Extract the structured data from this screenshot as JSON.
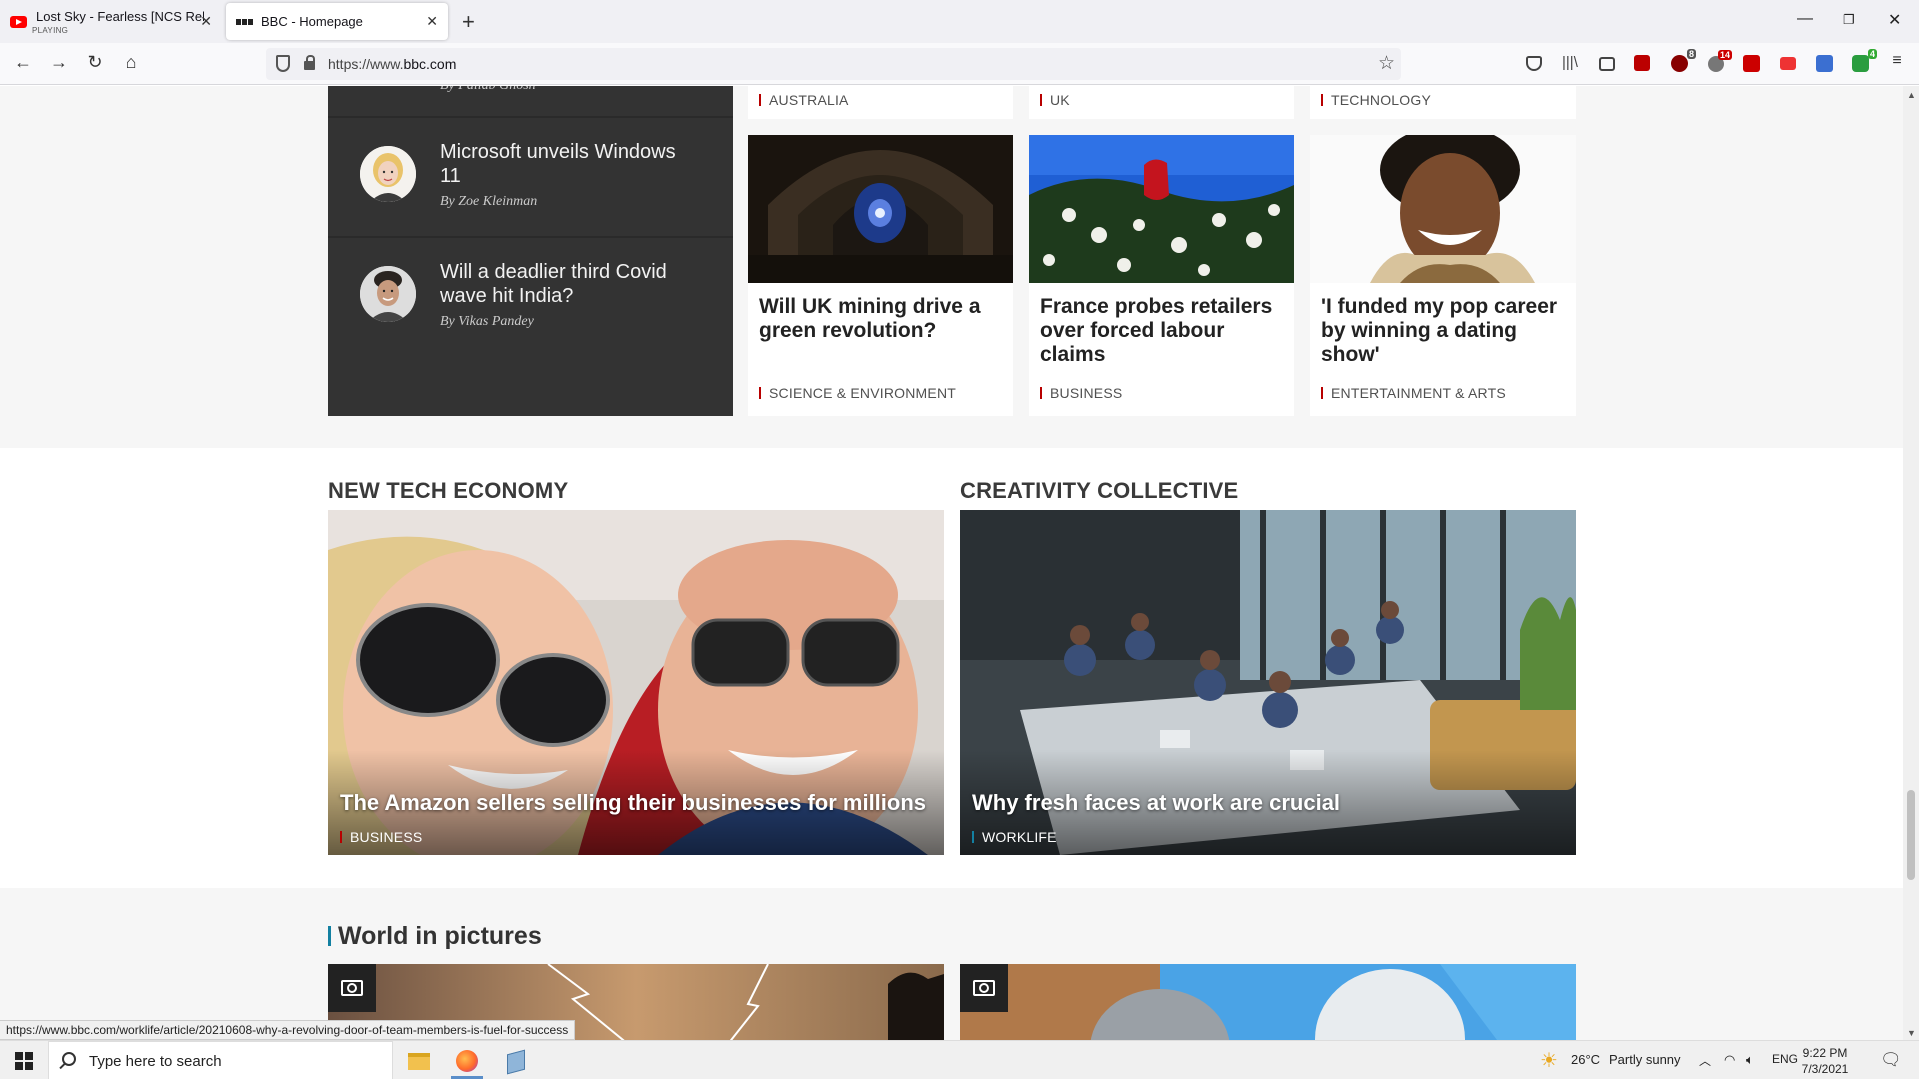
{
  "browser": {
    "tabs": [
      {
        "title": "Lost Sky - Fearless [NCS Release]",
        "sub": "PLAYING"
      },
      {
        "title": "BBC - Homepage"
      }
    ],
    "url_prefix": "https://www.",
    "url_domain": "bbc.com"
  },
  "authors_panel": {
    "partial_name": "By Pallab Ghosh",
    "items": [
      {
        "title": "Microsoft unveils Windows 11",
        "author": "By Zoe Kleinman"
      },
      {
        "title": "Will a deadlier third Covid wave hit India?",
        "author": "By Vikas Pandey"
      }
    ]
  },
  "top_tags": [
    "AUSTRALIA",
    "UK",
    "TECHNOLOGY"
  ],
  "cards": [
    {
      "title": "Will UK mining drive a green revolution?",
      "tag": "SCIENCE & ENVIRONMENT"
    },
    {
      "title": "France probes retailers over forced labour claims",
      "tag": "BUSINESS"
    },
    {
      "title": "'I funded my pop career by winning a dating show'",
      "tag": "ENTERTAINMENT & ARTS"
    }
  ],
  "features": [
    {
      "section": "NEW TECH ECONOMY",
      "title": "The Amazon sellers selling their businesses for millions",
      "tag": "BUSINESS"
    },
    {
      "section": "CREATIVITY COLLECTIVE",
      "title": "Why fresh faces at work are crucial",
      "tag": "WORKLIFE"
    }
  ],
  "world_in_pictures": {
    "heading": "World in pictures"
  },
  "status_url": "https://www.bbc.com/worklife/article/20210608-why-a-revolving-door-of-team-members-is-fuel-for-success",
  "extension_badges": [
    "8",
    "14",
    "4"
  ],
  "taskbar": {
    "search_placeholder": "Type here to search",
    "weather_temp": "26°C",
    "weather_text": "Partly sunny",
    "lang": "ENG",
    "time": "9:22 PM",
    "date": "7/3/2021"
  },
  "colors": {
    "bbc_red": "#b80000",
    "bbc_blue": "#1380a1",
    "dark_panel": "#333333"
  }
}
